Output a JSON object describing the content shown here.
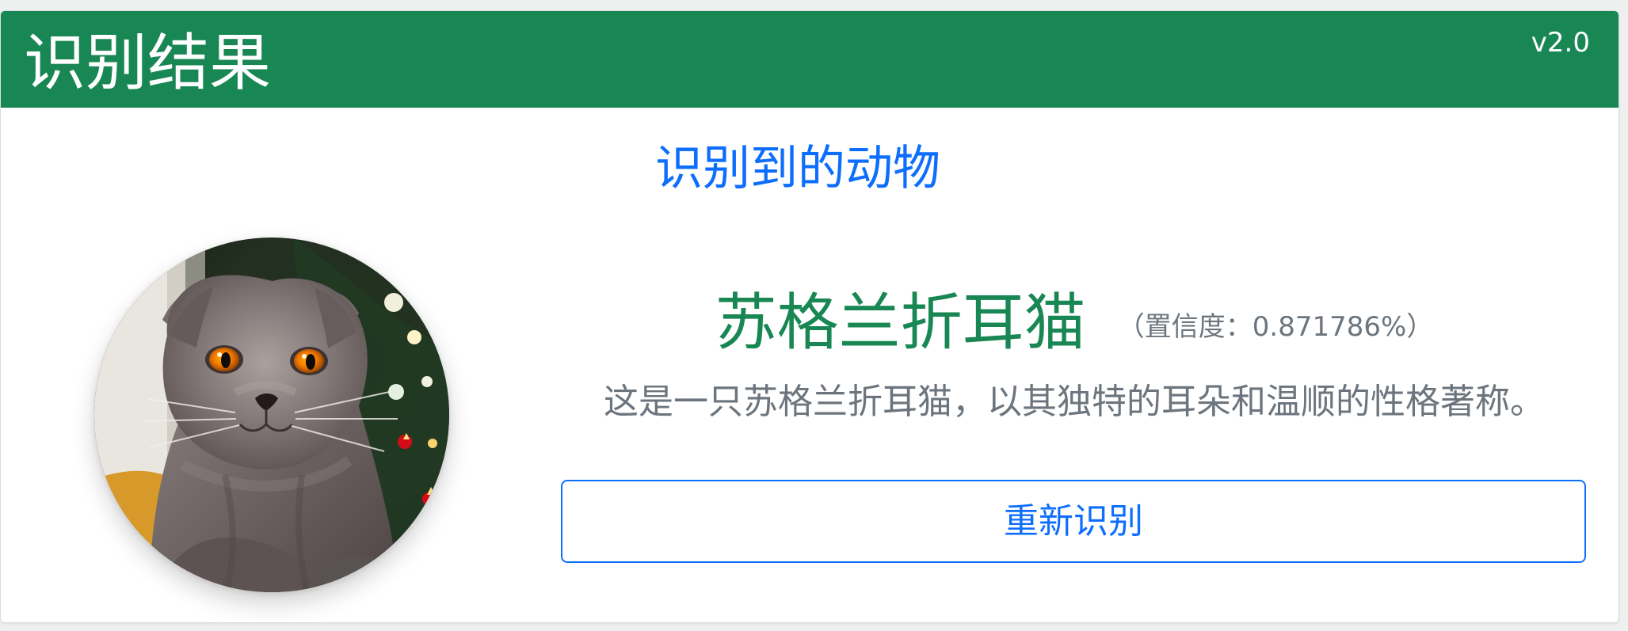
{
  "header": {
    "title": "识别结果",
    "version": "v2.0"
  },
  "section": {
    "title": "识别到的动物"
  },
  "result": {
    "animal": "苏格兰折耳猫",
    "confidence_label": "（置信度：0.871786%）",
    "confidence_value": 0.871786,
    "description": "这是一只苏格兰折耳猫，以其独特的耳朵和温顺的性格著称。"
  },
  "actions": {
    "retry_label": "重新识别"
  },
  "colors": {
    "header": "#198754",
    "accent": "#0d6efd",
    "animal_name": "#198754",
    "muted_text": "#6c757d"
  }
}
